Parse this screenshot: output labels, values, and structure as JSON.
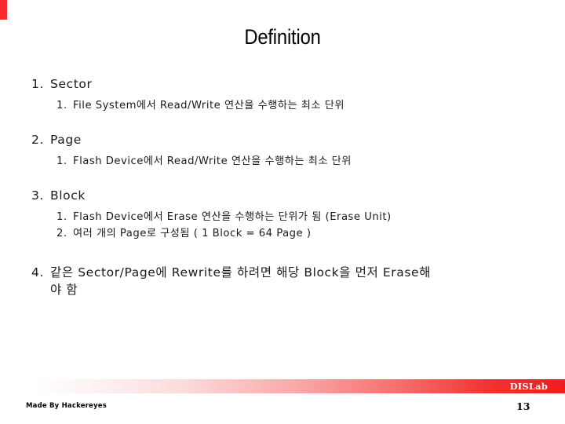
{
  "slide": {
    "title": "Definition",
    "accent_color": "#f72b2b"
  },
  "outline": {
    "item1": {
      "marker": "1.",
      "text": "Sector",
      "sub1": {
        "marker": "1.",
        "text": "File System에서 Read/Write 연산을 수행하는 최소 단위"
      }
    },
    "item2": {
      "marker": "2.",
      "text": "Page",
      "sub1": {
        "marker": "1.",
        "text": "Flash Device에서 Read/Write 연산을 수행하는 최소 단위"
      }
    },
    "item3": {
      "marker": "3.",
      "text": "Block",
      "sub1": {
        "marker": "1.",
        "text": "Flash Device에서 Erase 연산을 수행하는 단위가 됨 (Erase Unit)"
      },
      "sub2": {
        "marker": "2.",
        "text": "여러 개의 Page로 구성됨 ( 1 Block = 64 Page )"
      }
    },
    "item4": {
      "marker": "4.",
      "line1": "같은 Sector/Page에 Rewrite를 하려면 해당 Block을 먼저 Erase해",
      "line2": "야 함"
    }
  },
  "footer": {
    "brand": "DISLab",
    "credit": "Made By Hackereyes",
    "page_number": "13",
    "bar_color_start": "#ffffff",
    "bar_color_end": "#ef1c1c"
  }
}
